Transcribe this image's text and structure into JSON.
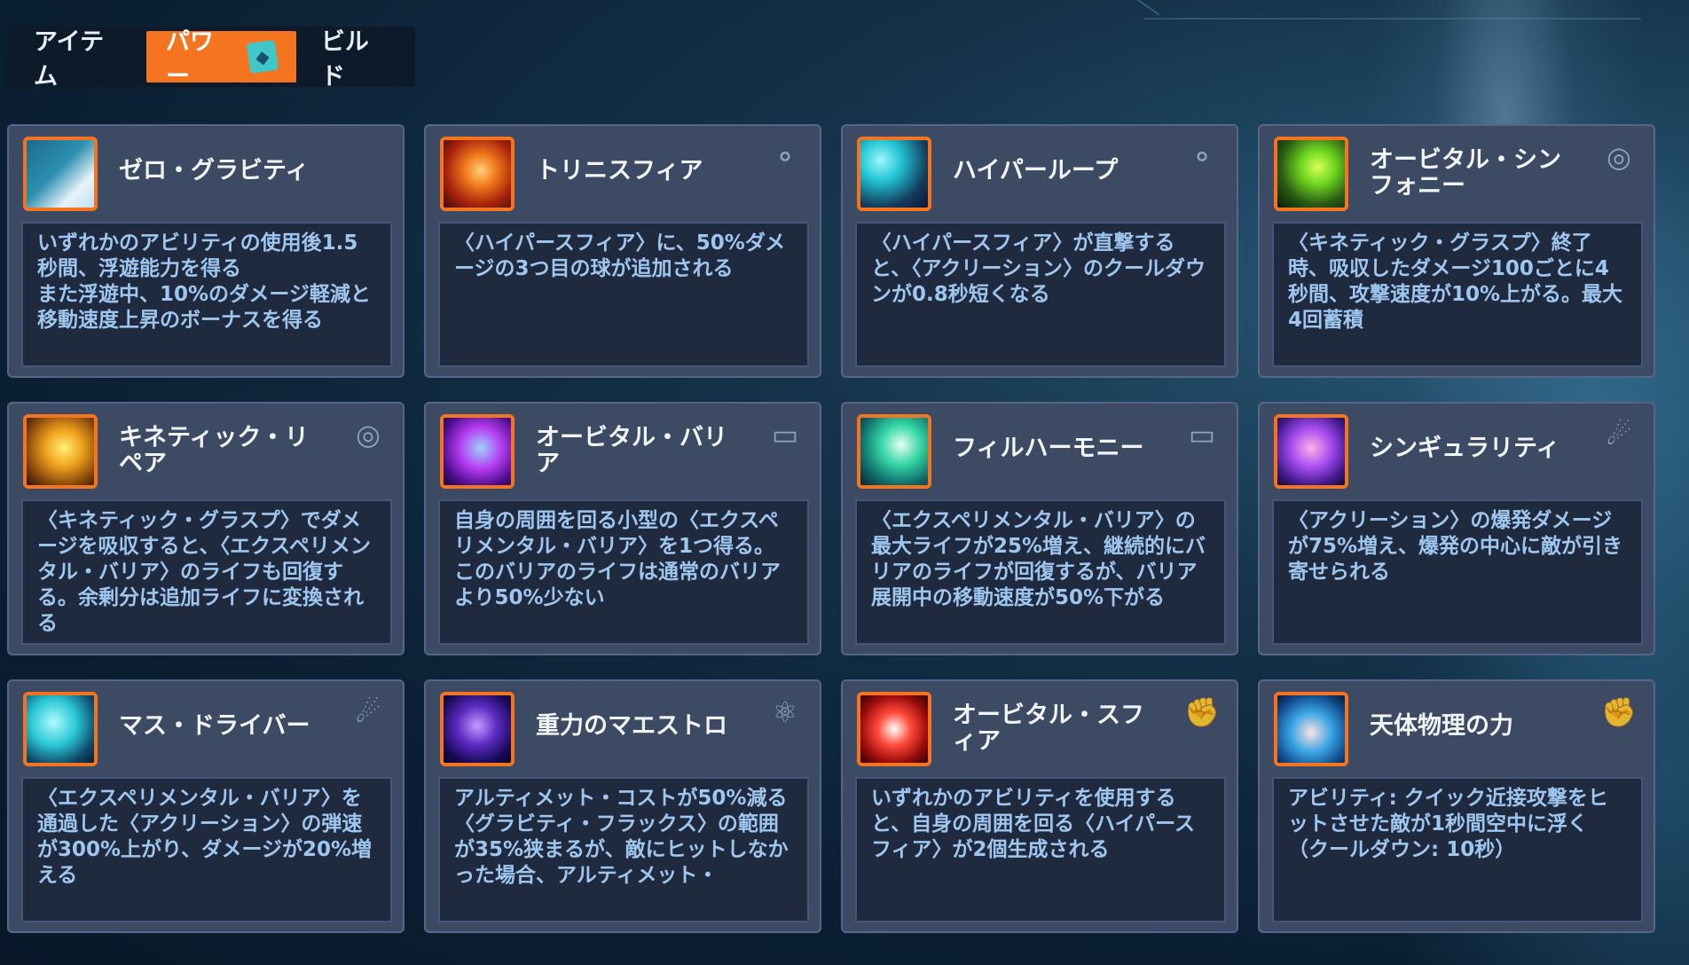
{
  "tabs": [
    {
      "label": "アイテム",
      "active": false
    },
    {
      "label": "パワー",
      "active": true
    },
    {
      "label": "ビルド",
      "active": false
    }
  ],
  "colors": {
    "accent": "#f47420",
    "card_bg": "#3d4a64",
    "desc_bg": "#1f2a3f",
    "desc_text": "#9fc6ee"
  },
  "cards": [
    {
      "title": "ゼロ・グラビティ",
      "icon": "zero-gravity-icon",
      "mark": "none",
      "desc": "いずれかのアビリティの使用後1.5秒間、浮遊能力を得る\nまた浮遊中、10%のダメージ軽減と移動速度上昇のボーナスを得る"
    },
    {
      "title": "トリニスフィア",
      "icon": "trinisphere-icon",
      "mark": "spheres-icon",
      "desc": "〈ハイパースフィア〉に、50%ダメージの3つ目の球が追加される"
    },
    {
      "title": "ハイパーループ",
      "icon": "hyperloop-icon",
      "mark": "spheres-icon",
      "desc": "〈ハイパースフィア〉が直撃すると、〈アクリーション〉のクールダウンが0.8秒短くなる"
    },
    {
      "title": "オービタル・シンフォニー",
      "icon": "orbital-symphony-icon",
      "mark": "vortex-icon",
      "desc": "〈キネティック・グラスプ〉終了時、吸収したダメージ100ごとに4秒間、攻撃速度が10%上がる。最大4回蓄積"
    },
    {
      "title": "キネティック・リペア",
      "icon": "kinetic-repair-icon",
      "mark": "vortex-icon",
      "desc": "〈キネティック・グラスプ〉でダメージを吸収すると、〈エクスペリメンタル・バリア〉のライフも回復する。余剰分は追加ライフに変換される"
    },
    {
      "title": "オービタル・バリア",
      "icon": "orbital-barrier-icon",
      "mark": "barrier-icon",
      "desc": "自身の周囲を回る小型の〈エクスペリメンタル・バリア〉を1つ得る。このバリアのライフは通常のバリアより50%少ない"
    },
    {
      "title": "フィルハーモニー",
      "icon": "philharmony-icon",
      "mark": "barrier-icon",
      "desc": "〈エクスペリメンタル・バリア〉の最大ライフが25%増え、継続的にバリアのライフが回復するが、バリア展開中の移動速度が50%下がる"
    },
    {
      "title": "シンギュラリティ",
      "icon": "singularity-icon",
      "mark": "comet-icon",
      "desc": "〈アクリーション〉の爆発ダメージが75%増え、爆発の中心に敵が引き寄せられる"
    },
    {
      "title": "マス・ドライバー",
      "icon": "mass-driver-icon",
      "mark": "comet-icon",
      "desc": "〈エクスペリメンタル・バリア〉を通過した〈アクリーション〉の弾速が300%上がり、ダメージが20%増える"
    },
    {
      "title": "重力のマエストロ",
      "icon": "gravity-maestro-icon",
      "mark": "atom-icon",
      "desc": "アルティメット・コストが50%減る\n〈グラビティ・フラックス〉の範囲が35%狭まるが、敵にヒットしなかった場合、アルティメット・"
    },
    {
      "title": "オービタル・スフィア",
      "icon": "orbital-sphere-icon",
      "mark": "fist-icon",
      "desc": "いずれかのアビリティを使用すると、自身の周囲を回る〈ハイパースフィア〉が2個生成される"
    },
    {
      "title": "天体物理の力",
      "icon": "astrophysical-force-icon",
      "mark": "fist-icon",
      "desc": "アビリティ: クイック近接攻撃をヒットさせた敵が1秒間空中に浮く（クールダウン: 10秒）"
    }
  ]
}
